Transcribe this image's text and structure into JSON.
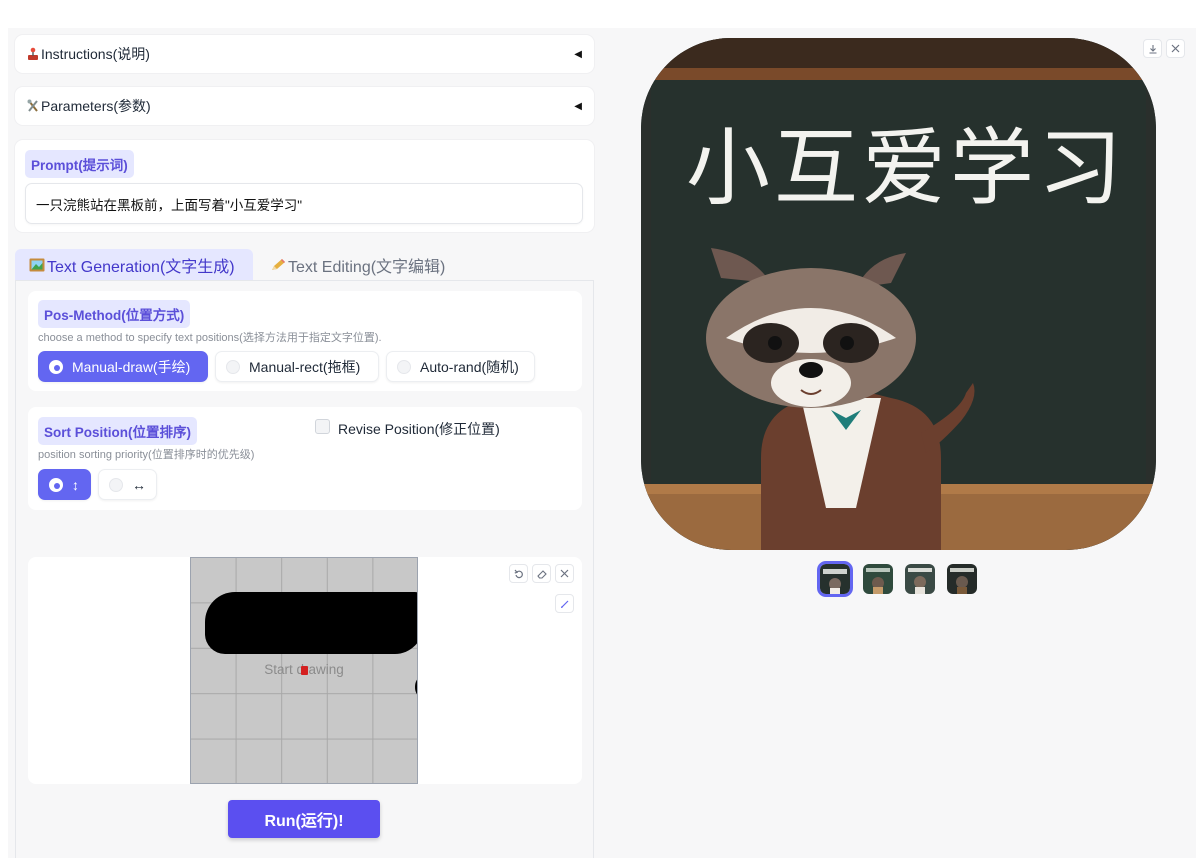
{
  "accordions": {
    "instructions_label": "Instructions(说明)",
    "parameters_label": "Parameters(参数)",
    "arrow": "◀"
  },
  "prompt": {
    "tag": "Prompt(提示词)",
    "value": "一只浣熊站在黑板前，上面写着\"小互爱学习\""
  },
  "tabs": {
    "generation": "Text Generation(文字生成)",
    "editing": "Text Editing(文字编辑)"
  },
  "pos_method": {
    "tag": "Pos-Method(位置方式)",
    "description": "choose a method to specify text positions(选择方法用于指定文字位置).",
    "options": [
      "Manual-draw(手绘)",
      "Manual-rect(拖框)",
      "Auto-rand(随机)"
    ],
    "selected": "Manual-draw(手绘)"
  },
  "sort_position": {
    "tag": "Sort Position(位置排序)",
    "description": "position sorting priority(位置排序时的优先级)",
    "options": [
      "↕",
      "↔"
    ],
    "revise_label": "Revise Position(修正位置)"
  },
  "canvas": {
    "hint": "Start drawing",
    "undo_icon": "undo-icon",
    "eraser_icon": "eraser-icon",
    "clear_icon": "close-icon",
    "brush_icon": "brush-icon"
  },
  "run_button": "Run(运行)!",
  "output": {
    "chalkboard_text": "小互爱学习",
    "download_icon": "download-icon",
    "close_icon": "close-icon",
    "thumbnail_count": 4
  },
  "colors": {
    "accent": "#6366f1",
    "tag_bg": "#e5e7ff",
    "run_button": "#5b4ff0",
    "chalkboard": "#25302c"
  }
}
